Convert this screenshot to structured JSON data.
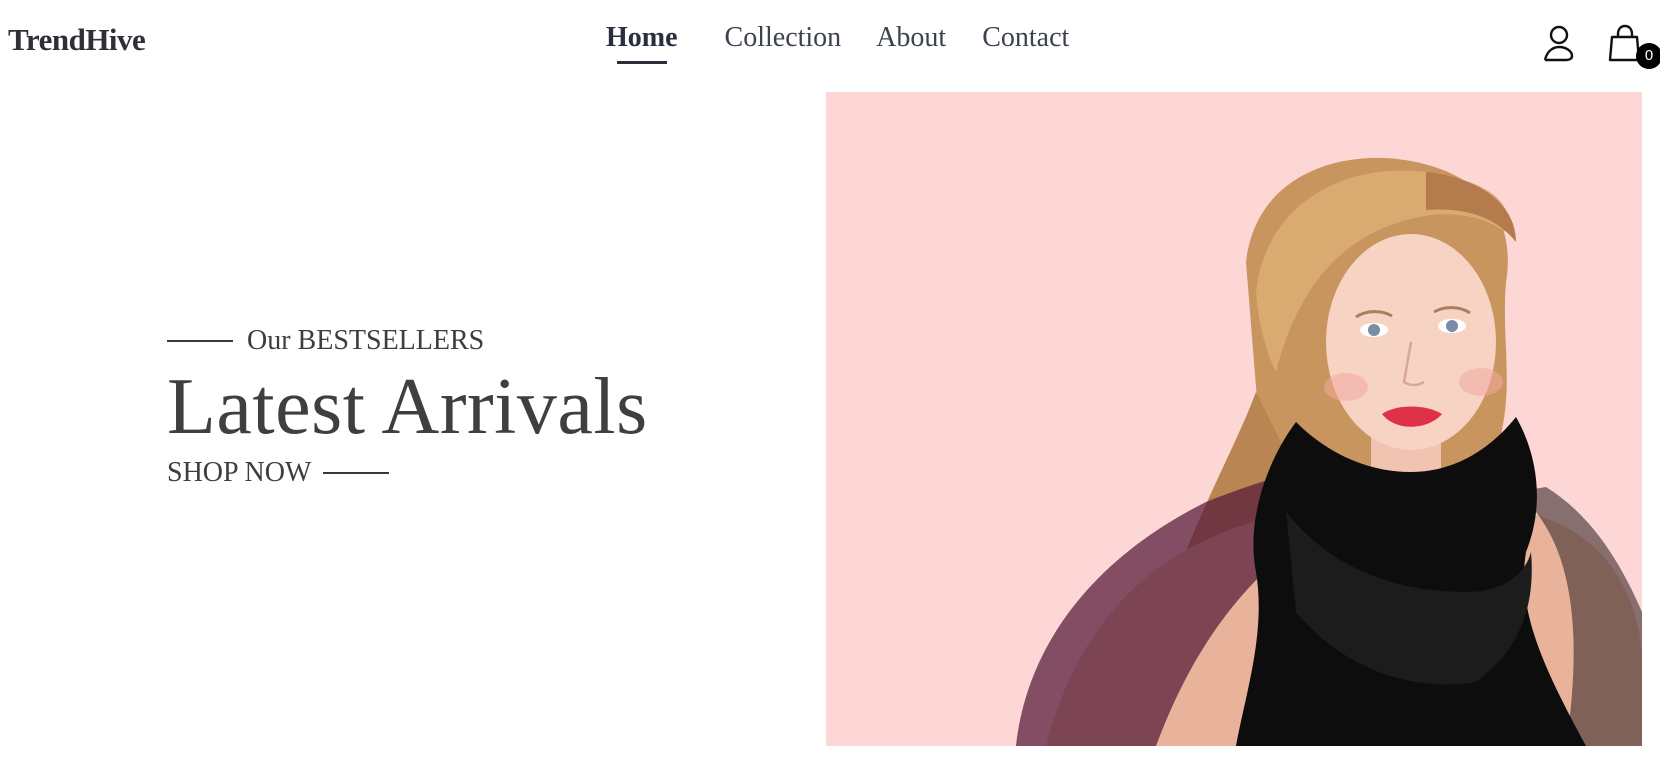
{
  "brand": {
    "name": "TrendHive"
  },
  "nav": {
    "items": [
      {
        "label": "Home",
        "active": true
      },
      {
        "label": "Collection",
        "active": false
      },
      {
        "label": "About",
        "active": false
      },
      {
        "label": "Contact",
        "active": false
      }
    ]
  },
  "header_icons": {
    "account_icon": "user-icon",
    "cart_icon": "shopping-bag-icon",
    "cart_count": "0"
  },
  "hero": {
    "eyebrow": "Our BESTSELLERS",
    "title": "Latest Arrivals",
    "cta": "SHOP NOW",
    "image_background": "#fdd7d5"
  },
  "colors": {
    "text_dark": "#2a2f3c",
    "badge_bg": "#000000",
    "hero_bg": "#fdd7d5"
  }
}
